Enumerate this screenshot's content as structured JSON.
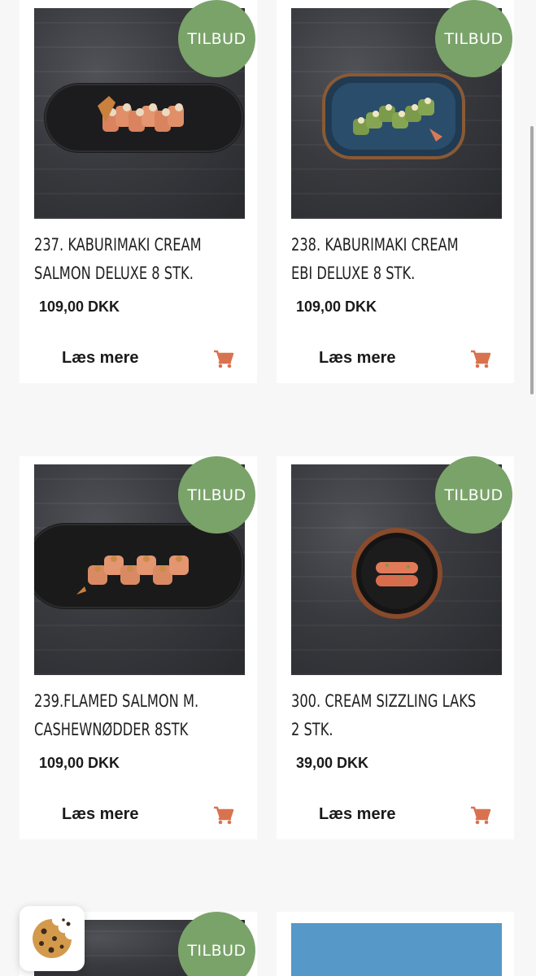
{
  "colors": {
    "badge_green": "#7aa36a",
    "cart_orange": "#d9724f",
    "page_bg": "#f7f7f7"
  },
  "products": [
    {
      "badge": "TILBUD",
      "title_line1": "237. KABURIMAKI CREAM",
      "title_line2": "SALMON DELUXE 8 STK.",
      "price": "109,00 DKK",
      "more_label": "Læs mere",
      "cart_icon": "cart-icon"
    },
    {
      "badge": "TILBUD",
      "title_line1": "238. KABURIMAKI CREAM",
      "title_line2": "EBI DELUXE 8 STK.",
      "price": "109,00 DKK",
      "more_label": "Læs mere",
      "cart_icon": "cart-icon"
    },
    {
      "badge": "TILBUD",
      "title_line1": "239.FLAMED SALMON M.",
      "title_line2": "CASHEWNØDDER 8STK",
      "price": "109,00 DKK",
      "more_label": "Læs mere",
      "cart_icon": "cart-icon"
    },
    {
      "badge": "TILBUD",
      "title_line1": "300. CREAM SIZZLING LAKS",
      "title_line2": "2 STK.",
      "price": "39,00 DKK",
      "more_label": "Læs mere",
      "cart_icon": "cart-icon"
    },
    {
      "badge": "TILBUD"
    }
  ],
  "cookie_button": {
    "icon": "cookie-icon"
  }
}
